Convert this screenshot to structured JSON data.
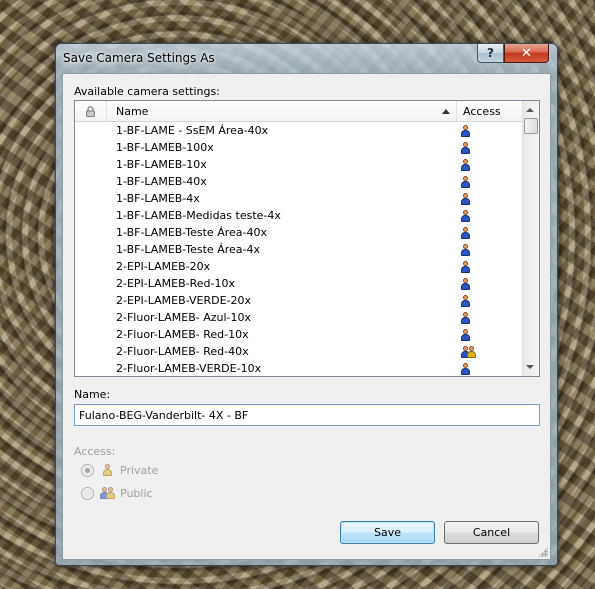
{
  "window": {
    "title": "Save Camera Settings As",
    "help_label": "?",
    "close_label": "✕"
  },
  "list": {
    "caption": "Available camera settings:",
    "columns": {
      "lock": "lock-icon",
      "name": "Name",
      "access": "Access"
    },
    "sort": "name-ascending",
    "rows": [
      {
        "name": "1-BF-LAME - SsEM Área-40x",
        "access": "private"
      },
      {
        "name": "1-BF-LAMEB-100x",
        "access": "private"
      },
      {
        "name": "1-BF-LAMEB-10x",
        "access": "private"
      },
      {
        "name": "1-BF-LAMEB-40x",
        "access": "private"
      },
      {
        "name": "1-BF-LAMEB-4x",
        "access": "private"
      },
      {
        "name": "1-BF-LAMEB-Medidas teste-4x",
        "access": "private"
      },
      {
        "name": "1-BF-LAMEB-Teste Área-40x",
        "access": "private"
      },
      {
        "name": "1-BF-LAMEB-Teste Área-4x",
        "access": "private"
      },
      {
        "name": "2-EPI-LAMEB-20x",
        "access": "private"
      },
      {
        "name": "2-EPI-LAMEB-Red-10x",
        "access": "private"
      },
      {
        "name": "2-EPI-LAMEB-VERDE-20x",
        "access": "private"
      },
      {
        "name": "2-Fluor-LAMEB- Azul-10x",
        "access": "private"
      },
      {
        "name": "2-Fluor-LAMEB- Red-10x",
        "access": "private"
      },
      {
        "name": "2-Fluor-LAMEB- Red-40x",
        "access": "public"
      },
      {
        "name": "2-Fluor-LAMEB-VERDE-10x",
        "access": "private"
      }
    ]
  },
  "name_field": {
    "label": "Name:",
    "value": "Fulano-BEG-Vanderbilt- 4X - BF"
  },
  "access": {
    "label": "Access:",
    "options": [
      {
        "label": "Private",
        "checked": true,
        "icon": "person-icon"
      },
      {
        "label": "Public",
        "checked": false,
        "icon": "people-icon"
      }
    ]
  },
  "buttons": {
    "save": "Save",
    "cancel": "Cancel"
  }
}
